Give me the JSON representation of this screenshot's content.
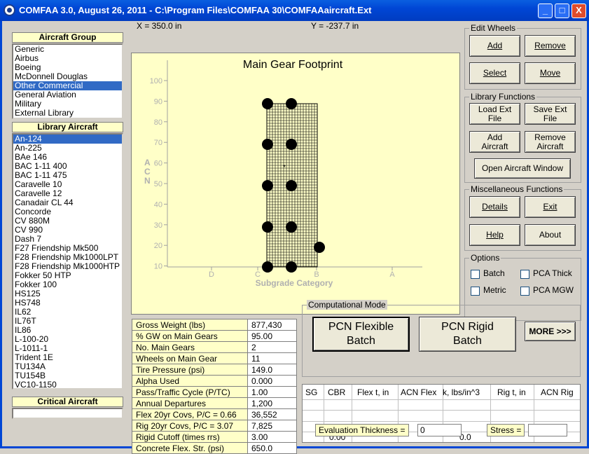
{
  "window": {
    "title": "COMFAA 3.0, August 26, 2011 - C:\\Program Files\\COMFAA 30\\COMFAAaircraft.Ext",
    "minimize": "_",
    "maximize": "□",
    "close": "X"
  },
  "coords": {
    "x": "X = 350.0 in",
    "y": "Y = -237.7 in"
  },
  "aircraft_group": {
    "header": "Aircraft Group",
    "items": [
      "Generic",
      "Airbus",
      "Boeing",
      "McDonnell Douglas",
      "Other Commercial",
      "General Aviation",
      "Military",
      "External Library"
    ],
    "selected": "Other Commercial"
  },
  "library_aircraft": {
    "header": "Library Aircraft",
    "items": [
      "An-124",
      "An-225",
      "BAe 146",
      "BAC 1-11 400",
      "BAC 1-11 475",
      "Caravelle 10",
      "Caravelle 12",
      "Canadair CL 44",
      "Concorde",
      "CV 880M",
      "CV 990",
      "Dash 7",
      "F27 Friendship Mk500",
      "F28 Friendship Mk1000LPT",
      "F28 Friendship Mk1000HTP",
      "Fokker 50 HTP",
      "Fokker 100",
      "HS125",
      "HS748",
      "IL62",
      "IL76T",
      "IL86",
      "L-100-20",
      "L-1011-1",
      "Trident 1E",
      "TU134A",
      "TU154B",
      "VC10-1150"
    ],
    "selected": "An-124"
  },
  "critical_aircraft": {
    "header": "Critical Aircraft",
    "value": ""
  },
  "plot": {
    "title": "Main Gear Footprint",
    "ylabel": "ACN",
    "xlabel": "Subgrade Category",
    "yticks": [
      "100",
      "90",
      "80",
      "70",
      "60",
      "50",
      "40",
      "30",
      "20",
      "10"
    ],
    "xticks": [
      "D",
      "C",
      "B",
      "A"
    ],
    "wheel_count": 11
  },
  "edit_wheels": {
    "title": "Edit Wheels",
    "add": "Add",
    "remove": "Remove",
    "select": "Select",
    "move": "Move"
  },
  "library_functions": {
    "title": "Library Functions",
    "load_ext": [
      "Load Ext",
      "File"
    ],
    "save_ext": [
      "Save Ext",
      "File"
    ],
    "add_aircraft": [
      "Add",
      "Aircraft"
    ],
    "remove_aircraft": [
      "Remove",
      "Aircraft"
    ],
    "open_window": "Open Aircraft Window"
  },
  "misc": {
    "title": "Miscellaneous Functions",
    "details": "Details",
    "exit": "Exit",
    "help": "Help",
    "about": "About"
  },
  "options": {
    "title": "Options",
    "batch": "Batch",
    "pca_thick": "PCA Thick",
    "metric": "Metric",
    "pca_mgw": "PCA MGW"
  },
  "params": [
    {
      "label": "Gross Weight (lbs)",
      "value": "877,430"
    },
    {
      "label": "% GW on Main Gears",
      "value": "95.00"
    },
    {
      "label": "No. Main Gears",
      "value": "2"
    },
    {
      "label": "Wheels on Main Gear",
      "value": "11"
    },
    {
      "label": "Tire Pressure (psi)",
      "value": "149.0"
    },
    {
      "label": "Alpha Used",
      "value": "0.000"
    },
    {
      "label": "Pass/Traffic Cycle (P/TC)",
      "value": "1.00"
    },
    {
      "label": "Annual Departures",
      "value": "1,200"
    },
    {
      "label": "Flex 20yr Covs, P/C = 0.66",
      "value": "36,552"
    },
    {
      "label": "Rig 20yr Covs,  P/C = 3.07",
      "value": "7,825"
    },
    {
      "label": "Rigid Cutoff (times rrs)",
      "value": "3.00"
    },
    {
      "label": "Concrete Flex. Str. (psi)",
      "value": "650.0"
    }
  ],
  "comp_mode": {
    "title": "Computational Mode",
    "pcn_flexible": [
      "PCN Flexible",
      "Batch"
    ],
    "pcn_rigid": [
      "PCN Rigid",
      "Batch"
    ],
    "more": "MORE >>>"
  },
  "results": {
    "headers": [
      "SG",
      "CBR",
      "Flex t, in",
      "ACN Flex",
      "k, lbs/in^3",
      "Rig t, in",
      "ACN Rig"
    ],
    "cbr_value": "0.00",
    "k_value": "0.0"
  },
  "evaluation": {
    "label": "Evaluation Thickness =",
    "value": "0"
  },
  "stress": {
    "label": "Stress =",
    "value": ""
  }
}
